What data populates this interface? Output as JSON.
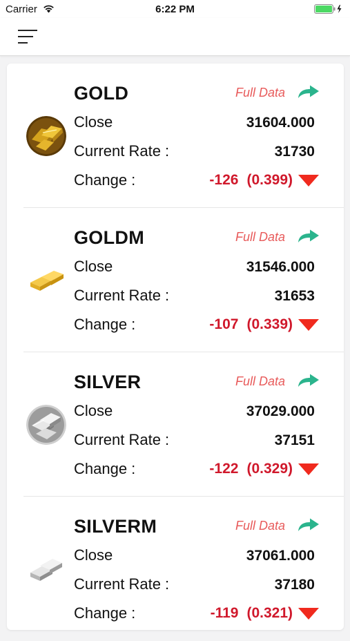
{
  "status_bar": {
    "carrier": "Carrier",
    "time": "6:22 PM"
  },
  "colors": {
    "accent_link": "#e85a5a",
    "share_arrow": "#2bb48d",
    "negative": "#d0182b"
  },
  "labels": {
    "full_data": "Full Data",
    "close": "Close",
    "current_rate": "Current Rate :",
    "change": "Change :"
  },
  "items": [
    {
      "name": "GOLD",
      "icon": "gold-bars-icon",
      "close": "31604.000",
      "current_rate": "31730",
      "change": "-126",
      "change_pct": "(0.399)",
      "direction": "down"
    },
    {
      "name": "GOLDM",
      "icon": "gold-mini-bars-icon",
      "close": "31546.000",
      "current_rate": "31653",
      "change": "-107",
      "change_pct": "(0.339)",
      "direction": "down"
    },
    {
      "name": "SILVER",
      "icon": "silver-bars-icon",
      "close": "37029.000",
      "current_rate": "37151",
      "change": "-122",
      "change_pct": "(0.329)",
      "direction": "down"
    },
    {
      "name": "SILVERM",
      "icon": "silver-mini-bars-icon",
      "close": "37061.000",
      "current_rate": "37180",
      "change": "-119",
      "change_pct": "(0.321)",
      "direction": "down"
    }
  ]
}
